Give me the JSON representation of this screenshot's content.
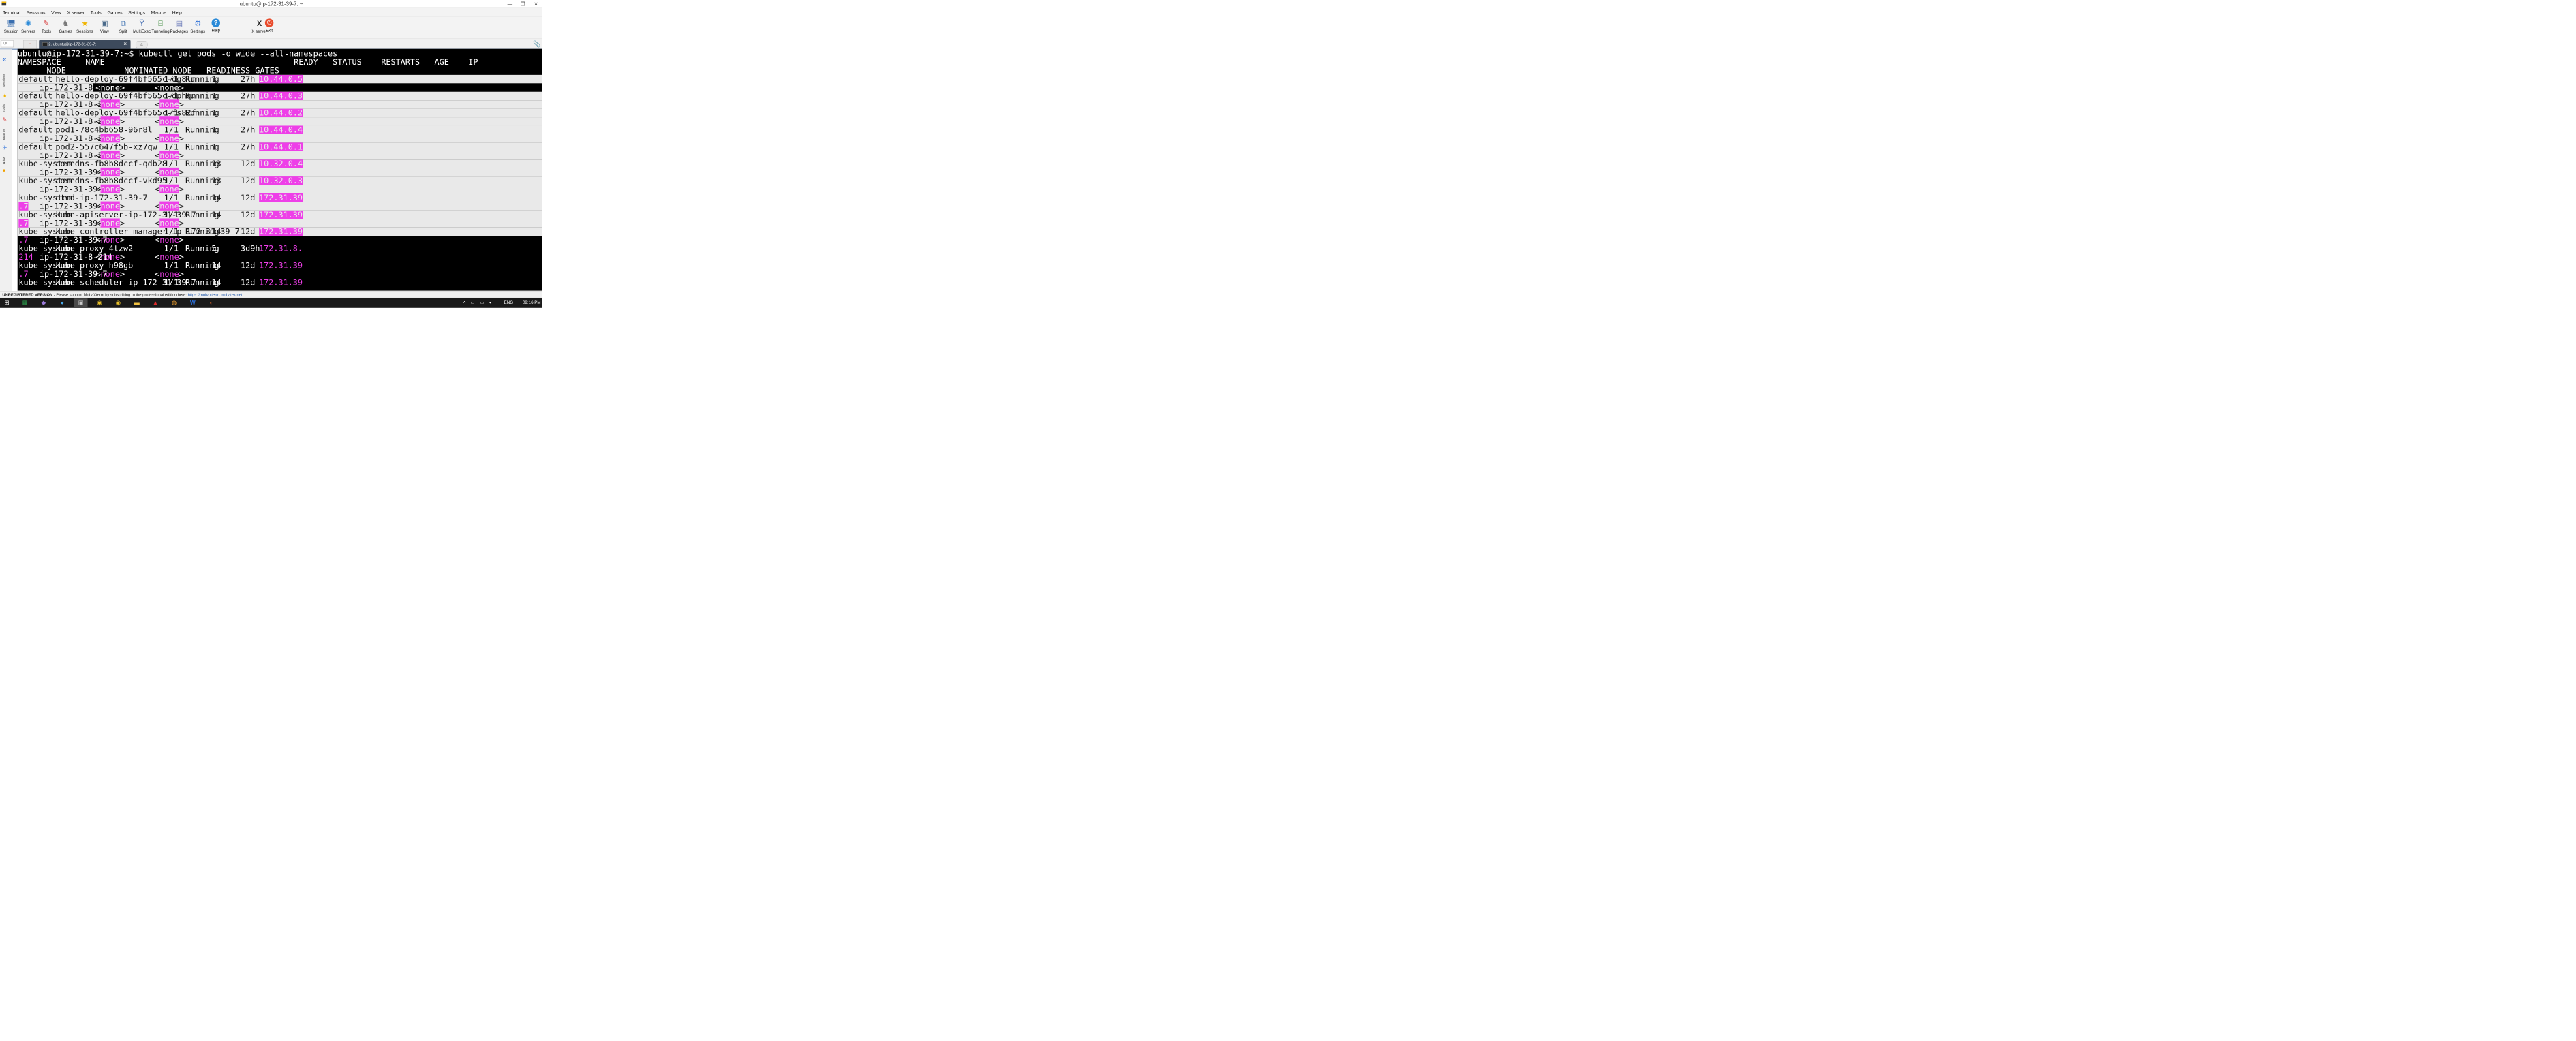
{
  "window": {
    "title": "ubuntu@ip-172-31-39-7: ~",
    "controls": {
      "minimize": "—",
      "maximize": "❐",
      "close": "✕"
    }
  },
  "menu": [
    "Terminal",
    "Sessions",
    "View",
    "X server",
    "Tools",
    "Games",
    "Settings",
    "Macros",
    "Help"
  ],
  "toolbar": {
    "left": [
      {
        "label": "Session",
        "icon": "session-icon"
      },
      {
        "label": "Servers",
        "icon": "servers-icon"
      },
      {
        "label": "Tools",
        "icon": "tools-icon"
      },
      {
        "label": "Games",
        "icon": "games-icon"
      },
      {
        "label": "Sessions",
        "icon": "star-icon"
      },
      {
        "label": "View",
        "icon": "view-icon"
      },
      {
        "label": "Split",
        "icon": "split-icon"
      },
      {
        "label": "MultiExec",
        "icon": "multiexec-icon"
      },
      {
        "label": "Tunneling",
        "icon": "tunneling-icon"
      },
      {
        "label": "Packages",
        "icon": "packages-icon"
      },
      {
        "label": "Settings",
        "icon": "gear-icon"
      },
      {
        "label": "Help",
        "icon": "help-icon"
      }
    ],
    "right": [
      {
        "label": "X server",
        "icon": "xserver-icon"
      },
      {
        "label": "Exit",
        "icon": "power-icon"
      }
    ]
  },
  "tabs": {
    "quick_connect_placeholder": "Qi",
    "terminal_tab": "2. ubuntu@ip-172-31-39-7: ~"
  },
  "sidebar": {
    "tabs": [
      "Sessions",
      "Tools",
      "Macros",
      "Sftp"
    ]
  },
  "terminal": {
    "prompt_line": "ubuntu@ip-172-31-39-7:~$ kubectl get pods -o wide --all-namespaces",
    "header_line1": "NAMESPACE     NAME                                       READY   STATUS    RESTARTS   AGE    IP",
    "header_line2": "      NODE            NOMINATED NODE   READINESS GATES",
    "rows": [
      {
        "ns": "default",
        "name": "hello-deploy-69f4bf565c-dg8lm",
        "ready": "1/1",
        "status": "Running",
        "restarts": "1",
        "age": "27h",
        "ip": "10.44.0.5",
        "ip_wrap": "",
        "node": "ip-172-31-8-214",
        "nominated": "<none>",
        "readiness": "<none>"
      },
      {
        "ns": "default",
        "name": "hello-deploy-69f4bf565c-dphqn",
        "ready": "1/1",
        "status": "Running",
        "restarts": "1",
        "age": "27h",
        "ip": "10.44.0.3",
        "ip_wrap": "",
        "node": "ip-172-31-8-214",
        "nominated": "<none>",
        "readiness": "<none>"
      },
      {
        "ns": "default",
        "name": "hello-deploy-69f4bf565c-fs82f",
        "ready": "1/1",
        "status": "Running",
        "restarts": "1",
        "age": "27h",
        "ip": "10.44.0.2",
        "ip_wrap": "",
        "node": "ip-172-31-8-214",
        "nominated": "<none>",
        "readiness": "<none>"
      },
      {
        "ns": "default",
        "name": "pod1-78c4bb658-96r8l",
        "ready": "1/1",
        "status": "Running",
        "restarts": "1",
        "age": "27h",
        "ip": "10.44.0.4",
        "ip_wrap": "",
        "node": "ip-172-31-8-214",
        "nominated": "<none>",
        "readiness": "<none>"
      },
      {
        "ns": "default",
        "name": "pod2-557c647f5b-xz7qw",
        "ready": "1/1",
        "status": "Running",
        "restarts": "1",
        "age": "27h",
        "ip": "10.44.0.1",
        "ip_wrap": "",
        "node": "ip-172-31-8-214",
        "nominated": "<none>",
        "readiness": "<none>"
      },
      {
        "ns": "kube-system",
        "name": "coredns-fb8b8dccf-qdb28",
        "ready": "1/1",
        "status": "Running",
        "restarts": "13",
        "age": "12d",
        "ip": "10.32.0.4",
        "ip_wrap": "",
        "node": "ip-172-31-39-7",
        "nominated": "<none>",
        "readiness": "<none>"
      },
      {
        "ns": "kube-system",
        "name": "coredns-fb8b8dccf-vkd95",
        "ready": "1/1",
        "status": "Running",
        "restarts": "13",
        "age": "12d",
        "ip": "10.32.0.3",
        "ip_wrap": "",
        "node": "ip-172-31-39-7",
        "nominated": "<none>",
        "readiness": "<none>"
      },
      {
        "ns": "kube-system",
        "name": "etcd-ip-172-31-39-7",
        "ready": "1/1",
        "status": "Running",
        "restarts": "14",
        "age": "12d",
        "ip": "172.31.39",
        "ip_wrap": ".7",
        "node": "ip-172-31-39-7",
        "nominated": "<none>",
        "readiness": "<none>"
      },
      {
        "ns": "kube-system",
        "name": "kube-apiserver-ip-172-31-39-7",
        "ready": "1/1",
        "status": "Running",
        "restarts": "14",
        "age": "12d",
        "ip": "172.31.39",
        "ip_wrap": ".7",
        "node": "ip-172-31-39-7",
        "nominated": "<none>",
        "readiness": "<none>"
      },
      {
        "ns": "kube-system",
        "name": "kube-controller-manager-ip-172-31-39-7",
        "ready": "1/1",
        "status": "Running",
        "restarts": "14",
        "age": "12d",
        "ip": "172.31.39",
        "ip_wrap": ".7",
        "node": "ip-172-31-39-7",
        "nominated": "<none>",
        "readiness": "<none>"
      },
      {
        "ns": "kube-system",
        "name": "kube-proxy-4tzw2",
        "ready": "1/1",
        "status": "Running",
        "restarts": "5",
        "age": "3d9h",
        "ip": "172.31.8.",
        "ip_wrap": "214",
        "node": "ip-172-31-8-214",
        "nominated": "<none>",
        "readiness": "<none>"
      },
      {
        "ns": "kube-system",
        "name": "kube-proxy-h98gb",
        "ready": "1/1",
        "status": "Running",
        "restarts": "14",
        "age": "12d",
        "ip": "172.31.39",
        "ip_wrap": ".7",
        "node": "ip-172-31-39-7",
        "nominated": "<none>",
        "readiness": "<none>"
      },
      {
        "ns": "kube-system",
        "name": "kube-scheduler-ip-172-31-39-7",
        "ready": "1/1",
        "status": "Running",
        "restarts": "14",
        "age": "12d",
        "ip": "172.31.39",
        "ip_wrap": "",
        "node": "",
        "nominated": "",
        "readiness": ""
      }
    ]
  },
  "statusbar": {
    "label": "UNREGISTERED VERSION",
    "message": " -  Please support MobaXterm by subscribing to the professional edition here:  ",
    "link": "https://mobaxterm.mobatek.net"
  },
  "taskbar": {
    "items": [
      "windows-start-icon",
      "excel-icon",
      "app-icon",
      "chat-icon",
      "mobaxterm-icon",
      "chrome-icon",
      "chrome-icon",
      "file-explorer-icon",
      "acrobat-icon",
      "app-icon",
      "word-icon",
      "firefox-icon"
    ],
    "language": "ENG",
    "time": "09:16 PM"
  },
  "colors": {
    "terminal_bg": "#000000",
    "selection_bg": "#e9e9e9",
    "ip_highlight": "#ee3fe8",
    "accent": "#2a6ed8"
  }
}
